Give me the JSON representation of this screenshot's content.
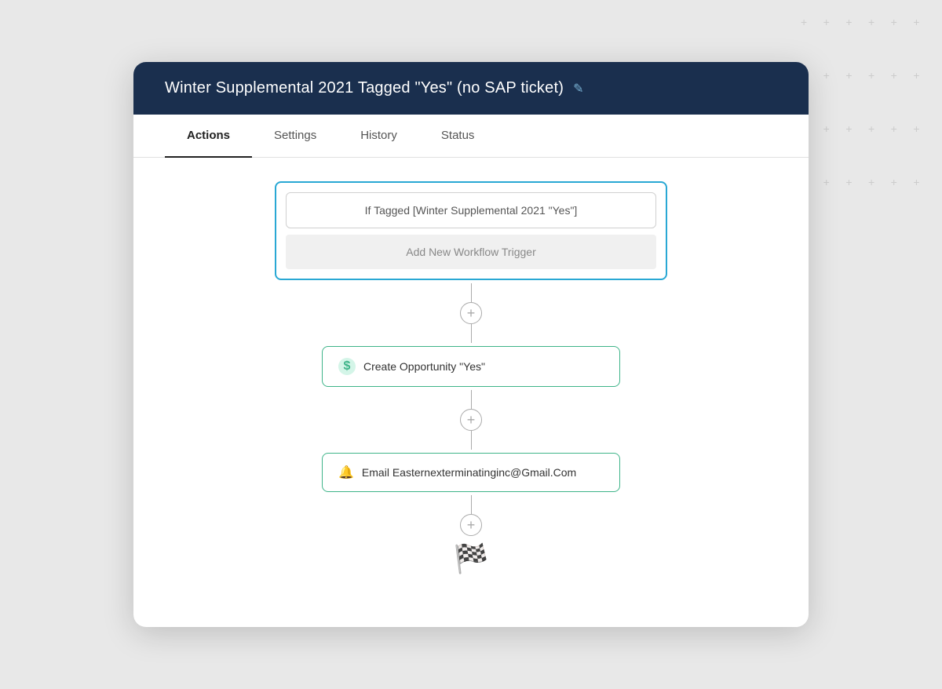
{
  "page": {
    "background": "#e8e8e8"
  },
  "modal": {
    "title": "Winter Supplemental 2021 Tagged \"Yes\" (no SAP ticket)",
    "edit_icon": "✎"
  },
  "tabs": [
    {
      "id": "actions",
      "label": "Actions",
      "active": true
    },
    {
      "id": "settings",
      "label": "Settings",
      "active": false
    },
    {
      "id": "history",
      "label": "History",
      "active": false
    },
    {
      "id": "status",
      "label": "Status",
      "active": false
    }
  ],
  "trigger_box": {
    "condition_text": "If Tagged [Winter Supplemental 2021 \"Yes\"]",
    "add_trigger_text": "Add New Workflow Trigger"
  },
  "actions": [
    {
      "id": "create-opportunity",
      "icon_type": "dollar",
      "icon_label": "$",
      "text": "Create Opportunity \"Yes\""
    },
    {
      "id": "email-action",
      "icon_type": "bell",
      "icon_label": "🔔",
      "text": "Email Easternexterminatinginc@Gmail.Com"
    }
  ],
  "connectors": {
    "add_label": "+"
  },
  "finish": {
    "icon": "🏁"
  }
}
